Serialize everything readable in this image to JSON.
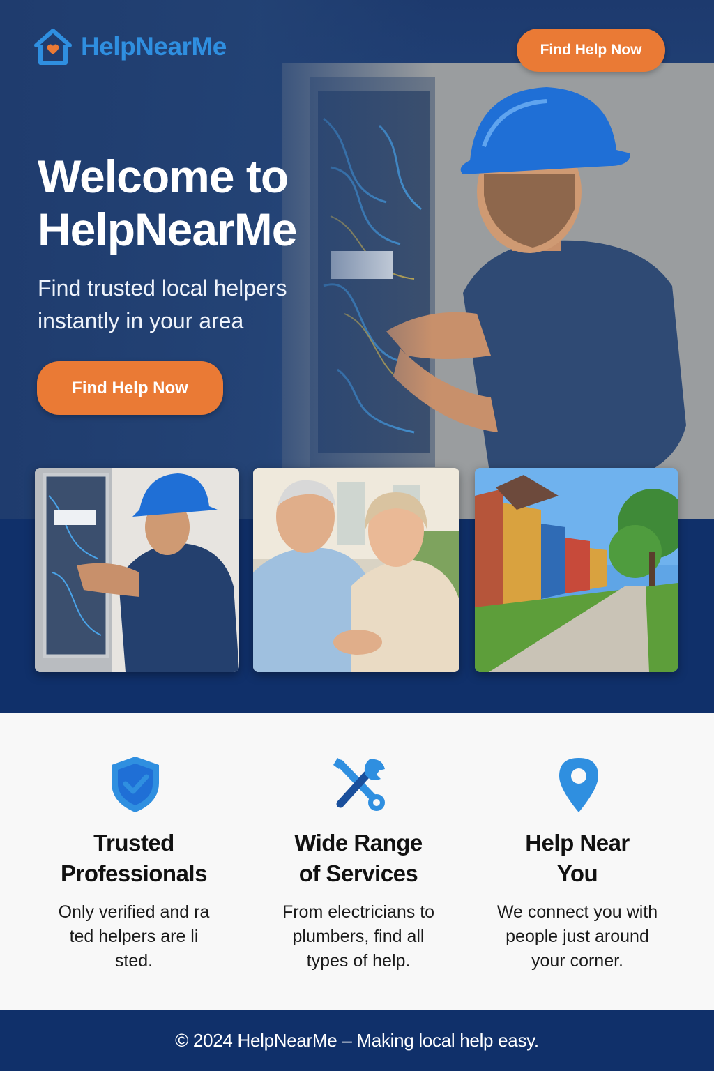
{
  "brand": {
    "name": "HelpNearMe",
    "color": "#2f8fe0"
  },
  "header": {
    "cta_label": "Find Help Now"
  },
  "hero": {
    "title_line1": "Welcome to",
    "title_line2": "HelpNearMe",
    "subtitle_line1": "Find trusted local helpers",
    "subtitle_line2": "instantly in your area",
    "cta_label": "Find Help Now"
  },
  "gallery": [
    {
      "icon": "electrician-photo"
    },
    {
      "icon": "senior-couple-photo"
    },
    {
      "icon": "neighborhood-street-photo"
    }
  ],
  "features": [
    {
      "icon": "shield-check-icon",
      "title_line1": "Trusted",
      "title_line2": "Professionals",
      "text_line1": "Only verified and ra",
      "text_line2": "ted helpers are li",
      "text_line3": "sted."
    },
    {
      "icon": "tools-icon",
      "title_line1": "Wide Range",
      "title_line2": "of Services",
      "text_line1": "From electricians to",
      "text_line2": "plumbers, find all",
      "text_line3": "types of help."
    },
    {
      "icon": "map-pin-icon",
      "title_line1": "Help Near",
      "title_line2": "You",
      "text_line1": "We connect you with",
      "text_line2": "people just around",
      "text_line3": "your corner."
    }
  ],
  "footer": {
    "text": "© 2024 HelpNearMe – Making local help easy."
  },
  "colors": {
    "accent": "#ea7a35",
    "navy": "#10306a",
    "icon_blue": "#2f8fe0"
  }
}
